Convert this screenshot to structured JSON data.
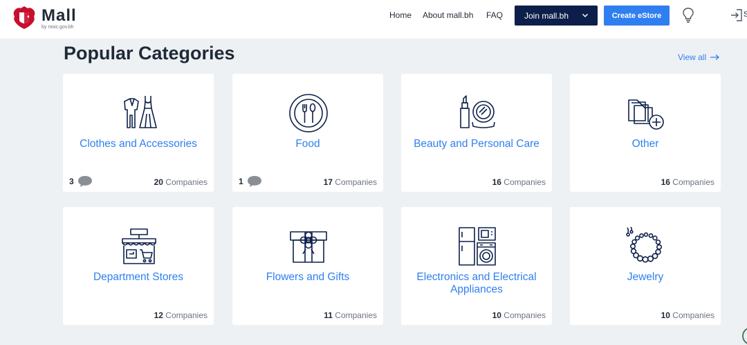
{
  "header": {
    "logo": {
      "name": "Mall",
      "subtitle": "by moic.gov.bh"
    },
    "nav": [
      {
        "label": "Home"
      },
      {
        "label": "About mall.bh"
      },
      {
        "label": "FAQ"
      }
    ],
    "join_label": "Join mall.bh",
    "create_label": "Create eStore",
    "signin_partial": "S"
  },
  "section": {
    "title": "Popular Categories",
    "view_all": "View all"
  },
  "categories": [
    {
      "title": "Clothes and Accessories",
      "icon": "clothes-icon",
      "comments": "3",
      "count": "20",
      "unit": "Companies"
    },
    {
      "title": "Food",
      "icon": "food-plate-icon",
      "comments": "1",
      "count": "17",
      "unit": "Companies"
    },
    {
      "title": "Beauty and Personal Care",
      "icon": "cosmetics-icon",
      "count": "16",
      "unit": "Companies"
    },
    {
      "title": "Other",
      "icon": "folders-add-icon",
      "count": "16",
      "unit": "Companies"
    },
    {
      "title": "Department Stores",
      "icon": "store-icon",
      "count": "12",
      "unit": "Companies"
    },
    {
      "title": "Flowers and Gifts",
      "icon": "gift-icon",
      "count": "11",
      "unit": "Companies"
    },
    {
      "title": "Electronics and Electrical Appliances",
      "icon": "appliances-icon",
      "count": "10",
      "unit": "Companies"
    },
    {
      "title": "Jewelry",
      "icon": "necklace-icon",
      "count": "10",
      "unit": "Companies"
    }
  ],
  "colors": {
    "accent": "#2f7ff0",
    "navy": "#0c1f4a",
    "background": "#eef1f4",
    "emblem_red": "#c8102e"
  }
}
